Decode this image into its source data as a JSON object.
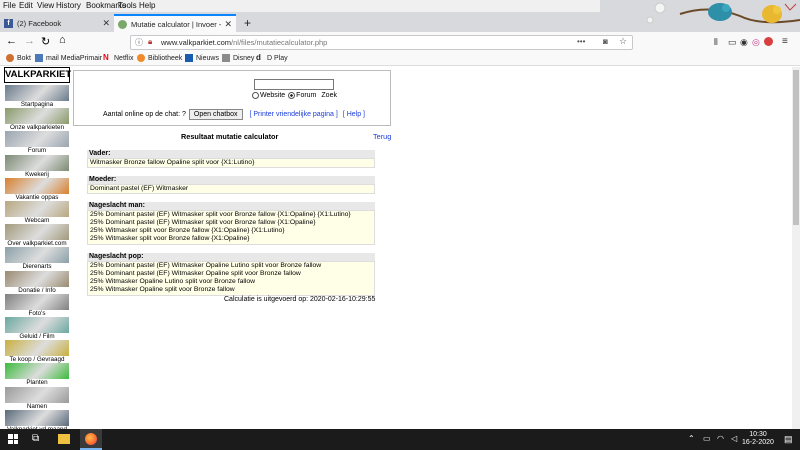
{
  "menu": [
    "File",
    "Edit",
    "View",
    "History",
    "Bookmarks",
    "Tools",
    "Help"
  ],
  "tabs": [
    {
      "label": "(2) Facebook",
      "active": false
    },
    {
      "label": "Mutatie calculator | Invoer - Va",
      "active": true
    }
  ],
  "url": "www.valkparkiet.com/nl/files/mutatiecalculator.php",
  "url_domain": "www.valkparkiet.com",
  "url_path": "/nl/files/mutatiecalculator.php",
  "bookmarks": [
    "Bokt",
    "mail MediaPrimair",
    "Netflix",
    "Bibliotheek",
    "Nieuws",
    "Disney",
    "D Play"
  ],
  "sidebar": [
    {
      "label": "Startpagina",
      "color": "#6a7a8c"
    },
    {
      "label": "Onze valkparkieten",
      "color": "#8a9a6a"
    },
    {
      "label": "Forum",
      "color": "#9aa4b0"
    },
    {
      "label": "Kwekerij",
      "color": "#7c8a74"
    },
    {
      "label": "Vakantie oppas",
      "color": "#d9802e"
    },
    {
      "label": "Webcam",
      "color": "#b8a880"
    },
    {
      "label": "Over valkparkiet.com",
      "color": "#a29a7c"
    },
    {
      "label": "Dierenarts",
      "color": "#8aa0a8"
    },
    {
      "label": "Donatie / Info",
      "color": "#9a8a70"
    },
    {
      "label": "Foto's",
      "color": "#808080"
    },
    {
      "label": "Geluid / Film",
      "color": "#6aa8a0"
    },
    {
      "label": "Te koop / Gevraagd",
      "color": "#c8b040"
    },
    {
      "label": "Planten",
      "color": "#3cba3c"
    },
    {
      "label": "Namen",
      "color": "#9a9a9a"
    },
    {
      "label": "Valkparkiet vd maand",
      "color": "#5a6a7a"
    }
  ],
  "sidebar_logo": "VALKPARKIET",
  "search": {
    "placeholder": "",
    "radio_website": "Website",
    "radio_forum": "Forum",
    "zoek": "Zoek",
    "chat_text": "Aantal online op de chat: ?",
    "open_chatbox": "Open chatbox",
    "printer_link": "[ Printer vriendelijke pagina ]",
    "help_link": "[ Help ]"
  },
  "result": {
    "title": "Resultaat mutatie calculator",
    "back": "Terug",
    "vader_label": "Vader:",
    "vader": "Witmasker Bronze fallow Opaline split voor {X1:Lutino}",
    "moeder_label": "Moeder:",
    "moeder": "Dominant pastel (EF) Witmasker",
    "man_label": "Nageslacht man:",
    "man": [
      "25% Dominant pastel (EF) Witmasker split voor Bronze fallow {X1:Opaline} {X1:Lutino}",
      "25% Dominant pastel (EF) Witmasker split voor Bronze fallow {X1:Opaline}",
      "25% Witmasker split voor Bronze fallow {X1:Opaline} {X1:Lutino}",
      "25% Witmasker split voor Bronze fallow {X1:Opaline}"
    ],
    "pop_label": "Nageslacht pop:",
    "pop": [
      "25% Dominant pastel (EF) Witmasker Opaline Lutino split voor Bronze fallow",
      "25% Dominant pastel (EF) Witmasker Opaline split voor Bronze fallow",
      "25% Witmasker Opaline Lutino split voor Bronze fallow",
      "25% Witmasker Opaline split voor Bronze fallow"
    ],
    "footer": "Calculatie is uitgevoerd op: 2020-02-16-10:29:55"
  },
  "clock": {
    "time": "10:30",
    "date": "16-2-2020"
  }
}
